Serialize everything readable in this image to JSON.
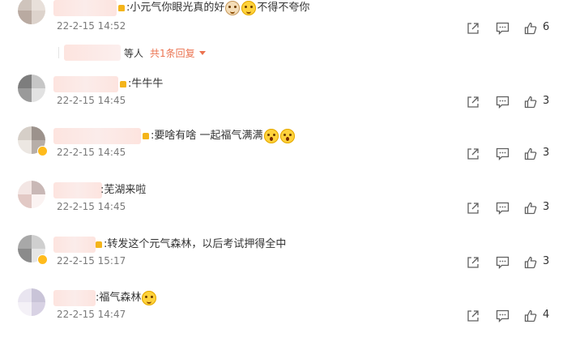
{
  "comments": [
    {
      "avatar_colors": [
        "#cfc4bc",
        "#e8e0da",
        "#b9aaa1",
        "#ddd3cc"
      ],
      "text": ":小元气你眼光真的好",
      "text_after": "不得不夸你",
      "emojis": [
        "dog-emoji",
        "smile-emoji"
      ],
      "time": "22-2-15 14:52",
      "likes": "6",
      "reply_summary": {
        "prefix": "等人",
        "link": "共1条回复"
      }
    },
    {
      "avatar_colors": [
        "#7d7d7d",
        "#c6c6c6",
        "#9a9a9a",
        "#e2e2e2"
      ],
      "text": ":牛牛牛",
      "time": "22-2-15 14:45",
      "likes": "3"
    },
    {
      "avatar_colors": [
        "#d6cfc8",
        "#9c928c",
        "#ece7e2",
        "#b7aea8"
      ],
      "text": ":要啥有啥 一起福气满满",
      "emojis": [
        "shock-emoji",
        "shock-emoji"
      ],
      "time": "22-2-15 14:45",
      "likes": "3"
    },
    {
      "avatar_colors": [
        "#f3e6e4",
        "#c9b8b6",
        "#e2c9c5",
        "#fbf3f2"
      ],
      "text": ":芜湖来啦",
      "time": "22-2-15 14:45",
      "likes": "3"
    },
    {
      "avatar_colors": [
        "#a8a8a8",
        "#cfcfcf",
        "#8b8b8b",
        "#e5e5e5"
      ],
      "text": ":转发这个元气森林，以后考试押得全中",
      "time": "22-2-15 15:17",
      "likes": "3"
    },
    {
      "avatar_colors": [
        "#e9e5f0",
        "#c9c4d8",
        "#f4f1f7",
        "#d8d2e4"
      ],
      "text": ":福气森林",
      "emojis": [
        "smile-emoji"
      ],
      "time": "22-2-15 14:47",
      "likes": "4"
    }
  ],
  "colors": {
    "link": "#eb7350",
    "time": "#7a7a7a",
    "icon": "#5f5f5f"
  }
}
